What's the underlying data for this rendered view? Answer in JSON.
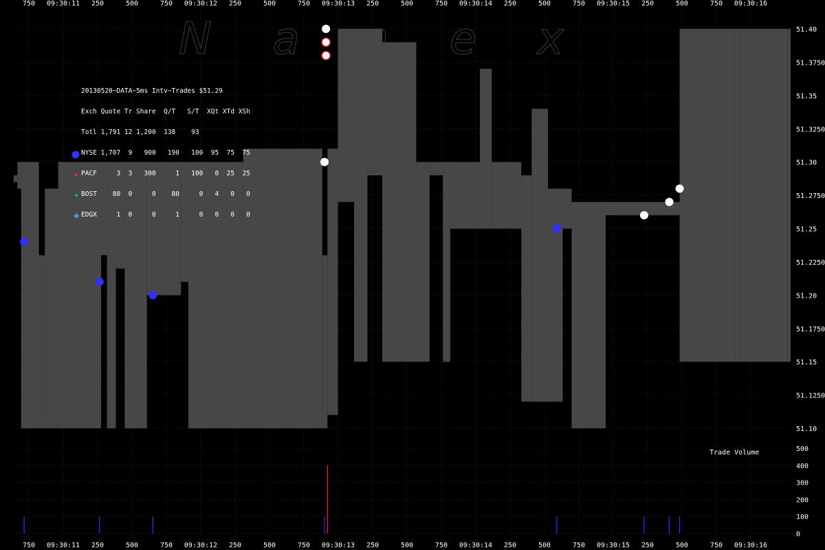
{
  "chart_data": {
    "type": "scatter",
    "watermark": "N a n e x",
    "stats": {
      "title": "20130520~DATA~5ms Intv~Trades $51.29",
      "header": "Exch Quote Tr Share  Q/T   S/T  XQt XTd XSh",
      "total": "Totl 1,791 12 1,200  138    93",
      "rows": [
        {
          "name": "NYSE",
          "text": "NYSE 1,707  9   900   190   100  95  75  75",
          "color": "#3030ff",
          "marker": "circle-large"
        },
        {
          "name": "PACF",
          "text": "PACF     3  3   300     1   100   0  25  25",
          "color": "#ff2020",
          "marker": "dot"
        },
        {
          "name": "BOST",
          "text": "BOST    80  0     0    80     0   4   0   0",
          "color": "#20c020",
          "marker": "dot"
        },
        {
          "name": "EDGX",
          "text": "EDGX     1  0     0     1     0   0   0   0",
          "color": "#30a0e0",
          "marker": "diamond"
        }
      ]
    },
    "x_ticks": [
      "750",
      "09:30:11",
      "250",
      "500",
      "750",
      "09:30:12",
      "250",
      "500",
      "750",
      "09:30:13",
      "250",
      "500",
      "750",
      "09:30:14",
      "250",
      "500",
      "750",
      "09:30:15",
      "250",
      "500",
      "750",
      "09:30:16"
    ],
    "y_price_ticks": [
      "51.40",
      "51.3750",
      "51.35",
      "51.3250",
      "51.30",
      "51.2750",
      "51.25",
      "51.2250",
      "51.20",
      "51.1750",
      "51.15",
      "51.1250",
      "51.10"
    ],
    "y_volume_ticks": [
      "500",
      "400",
      "300",
      "200",
      "100",
      "0"
    ],
    "volume_label": "Trade Volume",
    "price_range": [
      51.1,
      51.4
    ],
    "volume_range": [
      0,
      500
    ],
    "time_range_ms": [
      10750,
      16000
    ],
    "spread": [
      [
        10750,
        51.285,
        51.29
      ],
      [
        10775,
        51.28,
        51.3
      ],
      [
        10800,
        51.1,
        51.3
      ],
      [
        10920,
        51.1,
        51.23
      ],
      [
        10960,
        51.1,
        51.28
      ],
      [
        11050,
        51.1,
        51.3
      ],
      [
        11340,
        51.23,
        51.3
      ],
      [
        11380,
        51.1,
        51.3
      ],
      [
        11440,
        51.22,
        51.3
      ],
      [
        11500,
        51.1,
        51.3
      ],
      [
        11650,
        51.2,
        51.3
      ],
      [
        11880,
        51.21,
        51.3
      ],
      [
        11930,
        51.1,
        51.3
      ],
      [
        12300,
        51.1,
        51.31
      ],
      [
        12835,
        51.1,
        51.23
      ],
      [
        12870,
        51.11,
        51.31
      ],
      [
        12940,
        51.27,
        51.4
      ],
      [
        13050,
        51.15,
        51.4
      ],
      [
        13140,
        51.29,
        51.4
      ],
      [
        13240,
        51.15,
        51.39
      ],
      [
        13470,
        51.15,
        51.3
      ],
      [
        13560,
        51.29,
        51.3
      ],
      [
        13650,
        51.15,
        51.3
      ],
      [
        13700,
        51.25,
        51.3
      ],
      [
        13900,
        51.25,
        51.37
      ],
      [
        13980,
        51.25,
        51.3
      ],
      [
        14180,
        51.12,
        51.29
      ],
      [
        14250,
        51.12,
        51.34
      ],
      [
        14360,
        51.12,
        51.28
      ],
      [
        14460,
        51.25,
        51.28
      ],
      [
        14520,
        51.1,
        51.27
      ],
      [
        14750,
        51.26,
        51.27
      ],
      [
        15250,
        51.15,
        51.4
      ],
      [
        15430,
        51.15,
        51.4
      ],
      [
        15620,
        51.15,
        51.4
      ],
      [
        15660,
        51.15,
        51.4
      ],
      [
        15980,
        51.15,
        51.4
      ],
      [
        16000,
        51.15,
        51.4
      ]
    ],
    "trades": [
      {
        "t": 10820,
        "price": 51.24,
        "type": "nyse"
      },
      {
        "t": 11330,
        "price": 51.21,
        "type": "nyse"
      },
      {
        "t": 11690,
        "price": 51.2,
        "type": "nyse"
      },
      {
        "t": 12850,
        "price": 51.3,
        "type": "other"
      },
      {
        "t": 12860,
        "price": 51.38,
        "type": "pacf"
      },
      {
        "t": 12860,
        "price": 51.39,
        "type": "pacf"
      },
      {
        "t": 12860,
        "price": 51.4,
        "type": "other"
      },
      {
        "t": 14420,
        "price": 51.25,
        "type": "nyse"
      },
      {
        "t": 15010,
        "price": 51.26,
        "type": "other"
      },
      {
        "t": 15180,
        "price": 51.27,
        "type": "other"
      },
      {
        "t": 15250,
        "price": 51.28,
        "type": "other"
      }
    ],
    "volume_bars": [
      {
        "t": 10820,
        "v": 100,
        "color": "#3030ff"
      },
      {
        "t": 11330,
        "v": 100,
        "color": "#3030ff"
      },
      {
        "t": 11690,
        "v": 100,
        "color": "#3030ff"
      },
      {
        "t": 12850,
        "v": 100,
        "color": "#3030ff"
      },
      {
        "t": 12870,
        "v": 400,
        "color": "#ff2020"
      },
      {
        "t": 14420,
        "v": 100,
        "color": "#3030ff"
      },
      {
        "t": 15010,
        "v": 100,
        "color": "#3030ff"
      },
      {
        "t": 15180,
        "v": 100,
        "color": "#3030ff"
      },
      {
        "t": 15250,
        "v": 100,
        "color": "#3030ff"
      }
    ]
  }
}
